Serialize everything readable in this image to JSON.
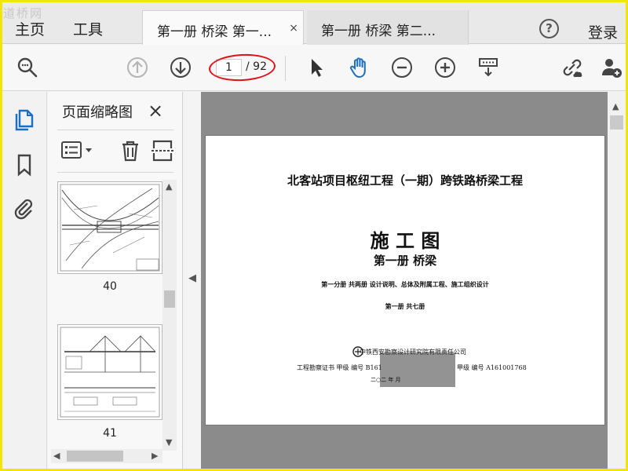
{
  "watermark": "道桥网",
  "nav": {
    "home": "主页",
    "tools": "工具"
  },
  "tabs": [
    {
      "label": "第一册 桥梁 第一...",
      "close": "×"
    },
    {
      "label": "第一册 桥梁 第二..."
    }
  ],
  "header": {
    "help": "?",
    "login": "登录"
  },
  "toolbar": {
    "page_current": "1",
    "page_total": "/ 92"
  },
  "panel": {
    "title": "页面缩略图",
    "close": "×",
    "thumbnails": [
      {
        "label": "40"
      },
      {
        "label": "41"
      }
    ]
  },
  "doc": {
    "project_title": "北客站项目枢纽工程（一期）跨铁路桥梁工程",
    "drawing_type": "施 工 图",
    "volume": "第一册 桥梁",
    "section_line": "第一分册 共两册    设计说明、总体及附属工程、施工组织设计",
    "book_line": "第一册  共七册",
    "company": "中铁西安勘察设计研究院有限责任公司",
    "cert_line": "工程勘察证书  甲级  编号  B161",
    "cert_line2": "甲级  编号  A161001768",
    "date_line": "二○二   年   月"
  },
  "colors": {
    "highlight_circle": "#e0101a",
    "frame": "#f2e600",
    "accent_blue": "#1b6fc2"
  }
}
